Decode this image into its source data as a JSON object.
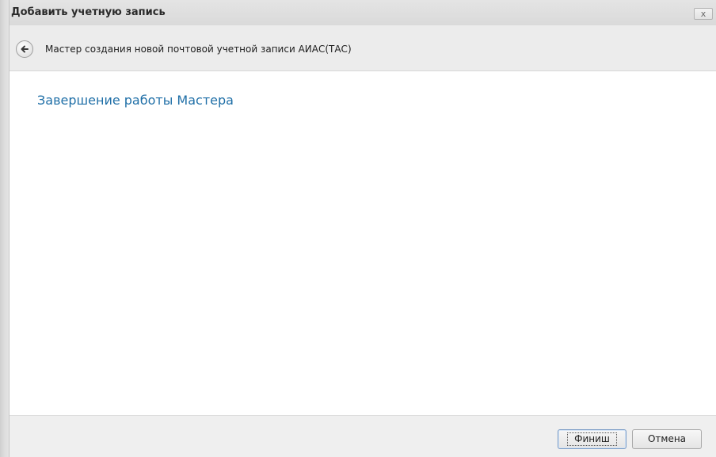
{
  "window": {
    "title": "Добавить учетную запись",
    "close_label": "x"
  },
  "header": {
    "back_icon": "back-arrow-icon",
    "wizard_title": "Мастер создания новой почтовой учетной записи АИАС(ТАС)"
  },
  "content": {
    "page_title": "Завершение работы Мастера"
  },
  "footer": {
    "finish_label": "Финиш",
    "cancel_label": "Отмена"
  },
  "colors": {
    "accent_title": "#1f6fa7"
  }
}
